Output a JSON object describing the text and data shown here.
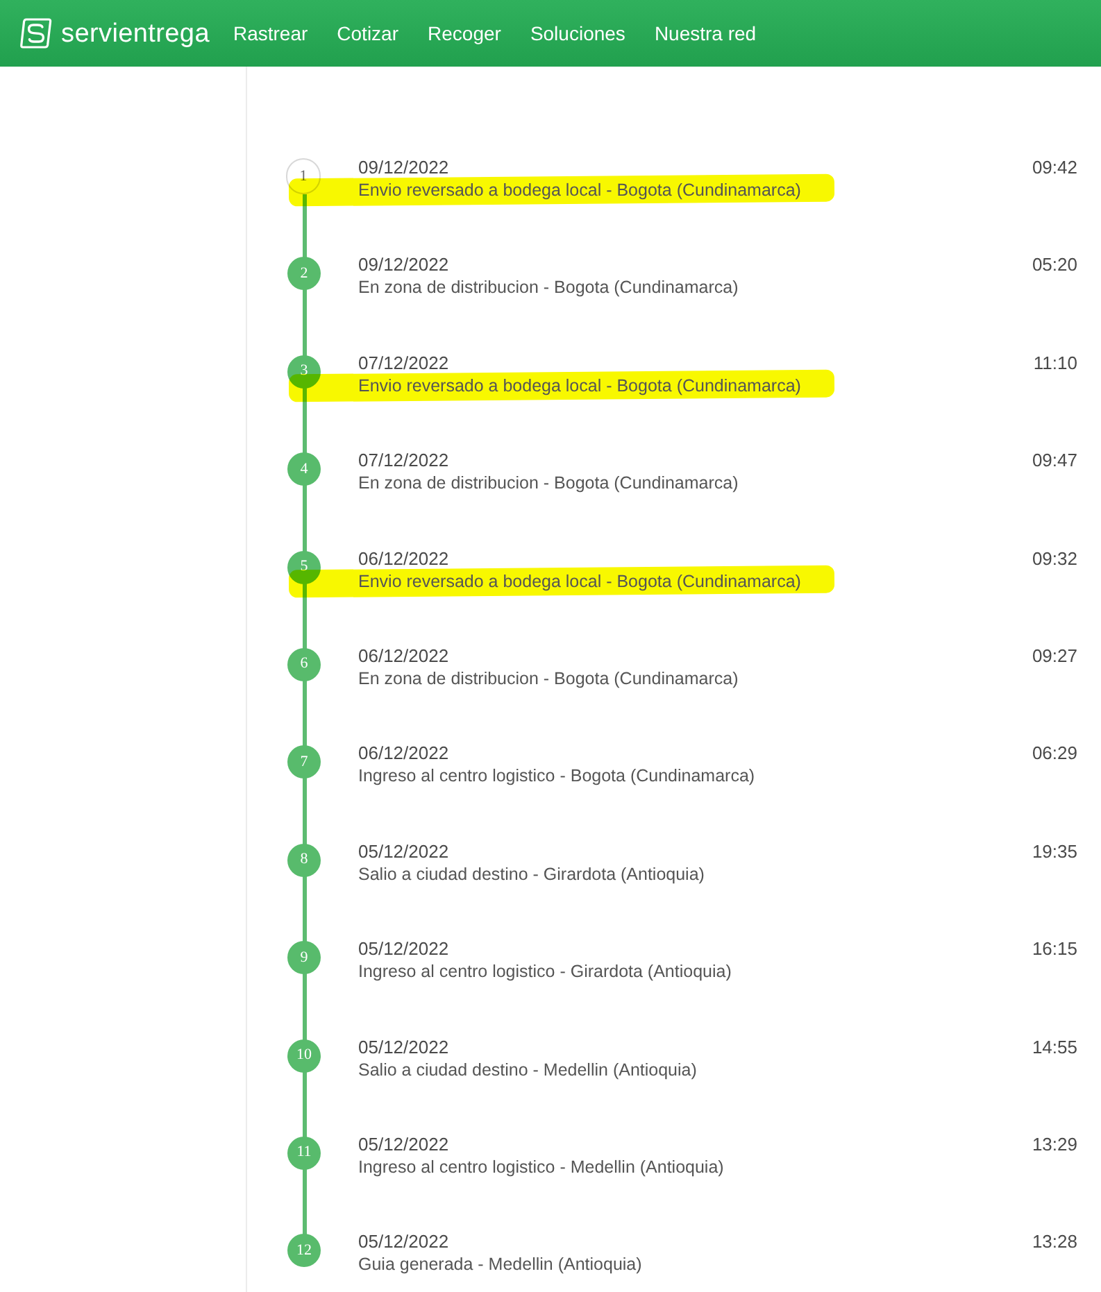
{
  "header": {
    "brand": "servientrega",
    "nav": [
      "Rastrear",
      "Cotizar",
      "Recoger",
      "Soluciones",
      "Nuestra red"
    ]
  },
  "events": [
    {
      "step": "1",
      "date": "09/12/2022",
      "description": "Envio reversado a bodega local - Bogota (Cundinamarca)",
      "time": "09:42",
      "current": true,
      "highlighted": true
    },
    {
      "step": "2",
      "date": "09/12/2022",
      "description": "En zona de distribucion - Bogota (Cundinamarca)",
      "time": "05:20",
      "current": false,
      "highlighted": false
    },
    {
      "step": "3",
      "date": "07/12/2022",
      "description": "Envio reversado a bodega local - Bogota (Cundinamarca)",
      "time": "11:10",
      "current": false,
      "highlighted": true
    },
    {
      "step": "4",
      "date": "07/12/2022",
      "description": "En zona de distribucion - Bogota (Cundinamarca)",
      "time": "09:47",
      "current": false,
      "highlighted": false
    },
    {
      "step": "5",
      "date": "06/12/2022",
      "description": "Envio reversado a bodega local - Bogota (Cundinamarca)",
      "time": "09:32",
      "current": false,
      "highlighted": true
    },
    {
      "step": "6",
      "date": "06/12/2022",
      "description": "En zona de distribucion - Bogota (Cundinamarca)",
      "time": "09:27",
      "current": false,
      "highlighted": false
    },
    {
      "step": "7",
      "date": "06/12/2022",
      "description": "Ingreso al centro logistico - Bogota (Cundinamarca)",
      "time": "06:29",
      "current": false,
      "highlighted": false
    },
    {
      "step": "8",
      "date": "05/12/2022",
      "description": "Salio a ciudad destino - Girardota (Antioquia)",
      "time": "19:35",
      "current": false,
      "highlighted": false
    },
    {
      "step": "9",
      "date": "05/12/2022",
      "description": "Ingreso al centro logistico - Girardota (Antioquia)",
      "time": "16:15",
      "current": false,
      "highlighted": false
    },
    {
      "step": "10",
      "date": "05/12/2022",
      "description": "Salio a ciudad destino - Medellin (Antioquia)",
      "time": "14:55",
      "current": false,
      "highlighted": false
    },
    {
      "step": "11",
      "date": "05/12/2022",
      "description": "Ingreso al centro logistico - Medellin (Antioquia)",
      "time": "13:29",
      "current": false,
      "highlighted": false
    },
    {
      "step": "12",
      "date": "05/12/2022",
      "description": "Guia generada - Medellin (Antioquia)",
      "time": "13:28",
      "current": false,
      "highlighted": false
    }
  ]
}
